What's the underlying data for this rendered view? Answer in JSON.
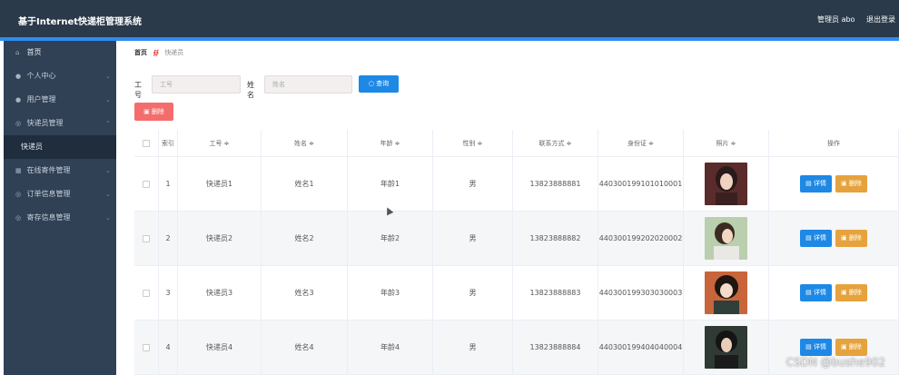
{
  "header": {
    "title": "基于Internet快递柜管理系统",
    "user_label": "管理员 abo",
    "logout_label": "退出登录"
  },
  "sidebar": {
    "items": [
      {
        "label": "首页",
        "icon": "home-icon",
        "chev": ""
      },
      {
        "label": "个人中心",
        "icon": "user-icon",
        "chev": "⌄"
      },
      {
        "label": "用户管理",
        "icon": "person-icon",
        "chev": "⌄"
      },
      {
        "label": "快递员管理",
        "icon": "courier-icon",
        "chev": "⌃"
      },
      {
        "label": "快递员",
        "icon": "",
        "chev": ""
      },
      {
        "label": "在线寄件管理",
        "icon": "package-icon",
        "chev": "⌄"
      },
      {
        "label": "订单信息管理",
        "icon": "order-icon",
        "chev": "⌄"
      },
      {
        "label": "寄存信息管理",
        "icon": "storage-icon",
        "chev": "⌄"
      }
    ]
  },
  "breadcrumb": {
    "home": "首页",
    "current": "快递员"
  },
  "search": {
    "code_label": "工号",
    "code_placeholder": "工号",
    "name_label": "姓名",
    "name_placeholder": "姓名",
    "query_label": "查询"
  },
  "toolbar": {
    "delete_label": "删除"
  },
  "table": {
    "headers": [
      "索引",
      "工号 ≑",
      "姓名 ≑",
      "年龄 ≑",
      "性别 ≑",
      "联系方式 ≑",
      "身份证 ≑",
      "照片 ≑",
      "操作"
    ],
    "rows": [
      {
        "index": "1",
        "code": "快递员1",
        "name": "姓名1",
        "age": "年龄1",
        "gender": "男",
        "phone": "13823888881",
        "idcard": "440300199101010001"
      },
      {
        "index": "2",
        "code": "快递员2",
        "name": "姓名2",
        "age": "年龄2",
        "gender": "男",
        "phone": "13823888882",
        "idcard": "440300199202020002"
      },
      {
        "index": "3",
        "code": "快递员3",
        "name": "姓名3",
        "age": "年龄3",
        "gender": "男",
        "phone": "13823888883",
        "idcard": "440300199303030003"
      },
      {
        "index": "4",
        "code": "快递员4",
        "name": "姓名4",
        "age": "年龄4",
        "gender": "男",
        "phone": "13823888884",
        "idcard": "440300199404040004"
      }
    ],
    "detail_label": "详情",
    "row_delete_label": "删除"
  },
  "watermark": "CSDN @bushe902",
  "colors": {
    "header_bg": "#2b3a4a",
    "sidebar_bg": "#304156",
    "accent": "#2d8cf0",
    "danger": "#f56c6c",
    "primary": "#1e88e5",
    "warning": "#e6a23c"
  }
}
